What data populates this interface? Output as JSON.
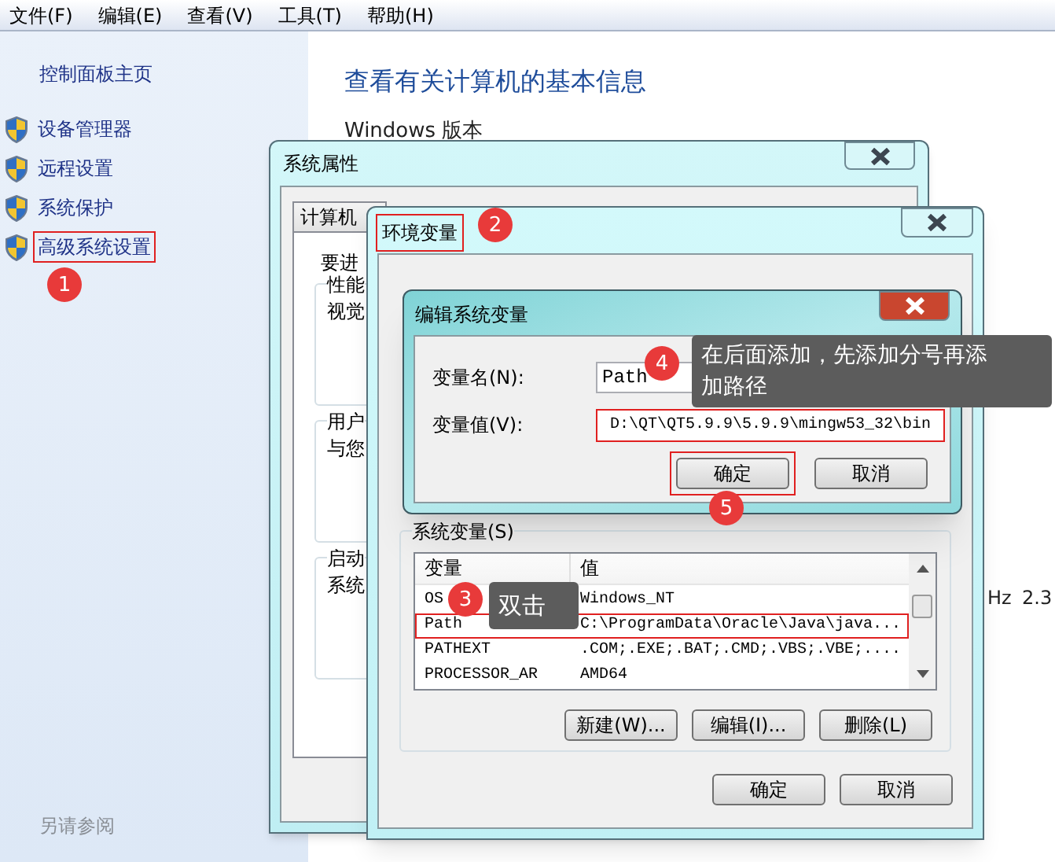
{
  "menu": [
    "文件(F)",
    "编辑(E)",
    "查看(V)",
    "工具(T)",
    "帮助(H)"
  ],
  "sidebar": {
    "home": "控制面板主页",
    "items": [
      {
        "label": "设备管理器",
        "highlighted": false
      },
      {
        "label": "远程设置",
        "highlighted": false
      },
      {
        "label": "系统保护",
        "highlighted": false
      },
      {
        "label": "高级系统设置",
        "highlighted": true,
        "badge": "1"
      }
    ],
    "see_also": "另请参阅"
  },
  "main": {
    "title": "查看有关计算机的基本信息",
    "edition_heading": "Windows 版本",
    "cpu_unit": "Hz",
    "cpu_speed": "2.3"
  },
  "system_properties": {
    "title": "系统属性",
    "tabs": [
      {
        "label": "计算机",
        "selected": false
      }
    ],
    "intro": "要进",
    "groups": [
      [
        "性能",
        "视觉"
      ],
      [
        "用户",
        "与您"
      ],
      [
        "启动",
        "系统"
      ]
    ]
  },
  "environment_variables": {
    "title": "环境变量",
    "highlighted": true,
    "badge": "2",
    "system_group": "系统变量(S)",
    "columns": [
      "变量",
      "值"
    ],
    "rows": [
      {
        "name": "OS",
        "value": "Windows_NT",
        "highlighted": false
      },
      {
        "name": "Path",
        "value": "C:\\ProgramData\\Oracle\\Java\\java...",
        "highlighted": true
      },
      {
        "name": "PATHEXT",
        "value": ".COM;.EXE;.BAT;.CMD;.VBS;.VBE;....",
        "highlighted": false
      },
      {
        "name": "PROCESSOR_AR",
        "value": "AMD64",
        "highlighted": false
      }
    ],
    "row_tooltip": {
      "badge": "3",
      "text": "双击"
    },
    "list_buttons": [
      "新建(W)...",
      "编辑(I)...",
      "删除(L)"
    ],
    "buttons": [
      "确定",
      "取消"
    ]
  },
  "edit_dialog": {
    "title": "编辑系统变量",
    "name_label": "变量名(N):",
    "name_value": "Path",
    "value_label": "变量值(V):",
    "value": "D:\\QT\\QT5.9.9\\5.9.9\\mingw53_32\\bin",
    "value_highlighted": true,
    "tooltip": {
      "badge": "4",
      "text": "在后面添加，先添加分号再添加路径"
    },
    "buttons": [
      {
        "label": "确定",
        "highlighted": true,
        "badge": "5"
      },
      {
        "label": "取消",
        "highlighted": false
      }
    ]
  }
}
